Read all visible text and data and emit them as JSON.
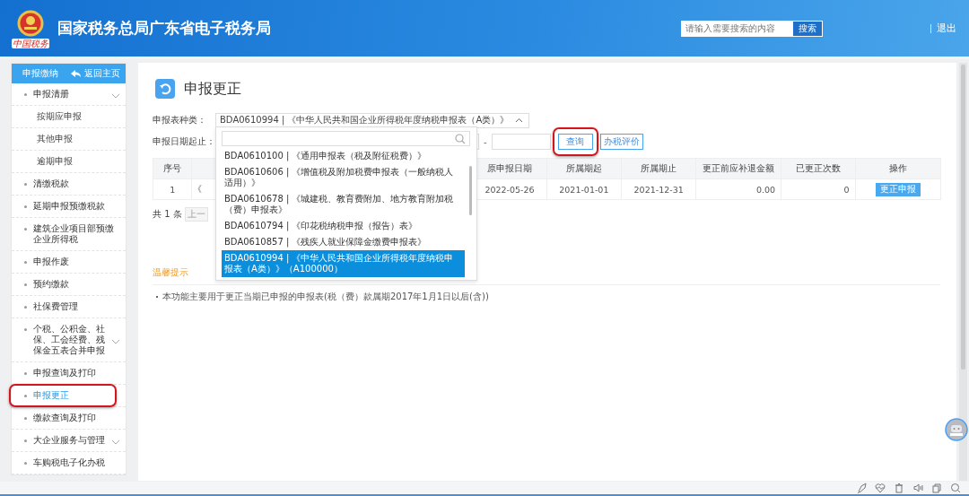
{
  "header": {
    "logo_text": "中国税务",
    "title": "国家税务总局广东省电子税务局",
    "search": {
      "placeholder": "请输入需要搜索的内容",
      "button": "搜索"
    },
    "logout": "退出"
  },
  "sidebar": {
    "title": "申报缴纳",
    "back_link": "返回主页",
    "items": [
      {
        "label": "申报清册",
        "has_submenu": true,
        "selected": false,
        "highlighted": false,
        "children": [
          {
            "label": "按期应申报",
            "selected": false
          },
          {
            "label": "其他申报",
            "selected": false
          },
          {
            "label": "逾期申报",
            "selected": false
          }
        ]
      },
      {
        "label": "清缴税款",
        "has_submenu": false,
        "selected": false,
        "highlighted": false
      },
      {
        "label": "延期申报预缴税款",
        "has_submenu": false,
        "selected": false,
        "highlighted": false
      },
      {
        "label": "建筑企业项目部预缴企业所得税",
        "has_submenu": false,
        "selected": false,
        "highlighted": false
      },
      {
        "label": "申报作废",
        "has_submenu": false,
        "selected": false,
        "highlighted": false
      },
      {
        "label": "预约缴款",
        "has_submenu": false,
        "selected": false,
        "highlighted": false
      },
      {
        "label": "社保费管理",
        "has_submenu": false,
        "selected": false,
        "highlighted": false
      },
      {
        "label": "个税、公积金、社保、工会经费、残保金五表合并申报",
        "has_submenu": true,
        "selected": false,
        "highlighted": false
      },
      {
        "label": "申报查询及打印",
        "has_submenu": false,
        "selected": false,
        "highlighted": false
      },
      {
        "label": "申报更正",
        "has_submenu": false,
        "selected": true,
        "highlighted": true
      },
      {
        "label": "缴款查询及打印",
        "has_submenu": false,
        "selected": false,
        "highlighted": false
      },
      {
        "label": "大企业服务与管理",
        "has_submenu": true,
        "selected": false,
        "highlighted": false
      },
      {
        "label": "车购税电子化办税",
        "has_submenu": false,
        "selected": false,
        "highlighted": false
      }
    ]
  },
  "page": {
    "title": "申报更正",
    "form": {
      "type_label": "申报表种类：",
      "type_value": "BDA0610994 | 《中华人民共和国企业所得税年度纳税申报表（A类）》",
      "date_label": "申报日期起止：",
      "date_separator": "-",
      "query_button": {
        "label": "查询",
        "highlighted": true
      },
      "rate_button": "办税评价"
    },
    "dropdown": {
      "open": true,
      "options": [
        {
          "label": "BDA0610100 | 《通用申报表（税及附征税费）》",
          "selected": false
        },
        {
          "label": "BDA0610606 | 《增值税及附加税费申报表（一般纳税人适用）》",
          "selected": false
        },
        {
          "label": "BDA0610678 | 《城建税、教育费附加、地方教育附加税（费）申报表》",
          "selected": false
        },
        {
          "label": "BDA0610794 | 《印花税纳税申报（报告）表》",
          "selected": false
        },
        {
          "label": "BDA0610857 | 《残疾人就业保障金缴费申报表》",
          "selected": false
        },
        {
          "label": "BDA0610994 | 《中华人民共和国企业所得税年度纳税申报表（A类）》（A100000）",
          "selected": true
        }
      ]
    },
    "table": {
      "columns": [
        "序号",
        "原申报日期",
        "所属期起",
        "所属期止",
        "更正前应补退金额",
        "已更正次数",
        "操作"
      ],
      "rows": [
        {
          "cells": [
            "1",
            "2022-05-26",
            "2021-01-01",
            "2021-12-31",
            "0.00",
            "0"
          ],
          "column_2": "《",
          "action": "更正申报"
        }
      ]
    },
    "pagination": {
      "total": "共 1 条",
      "prev": "上一"
    },
    "tips": {
      "title": "温馨提示",
      "items": [
        "本功能主要用于更正当期已申报的申报表(税（费）款属期2017年1月1日以后(含))"
      ]
    }
  }
}
